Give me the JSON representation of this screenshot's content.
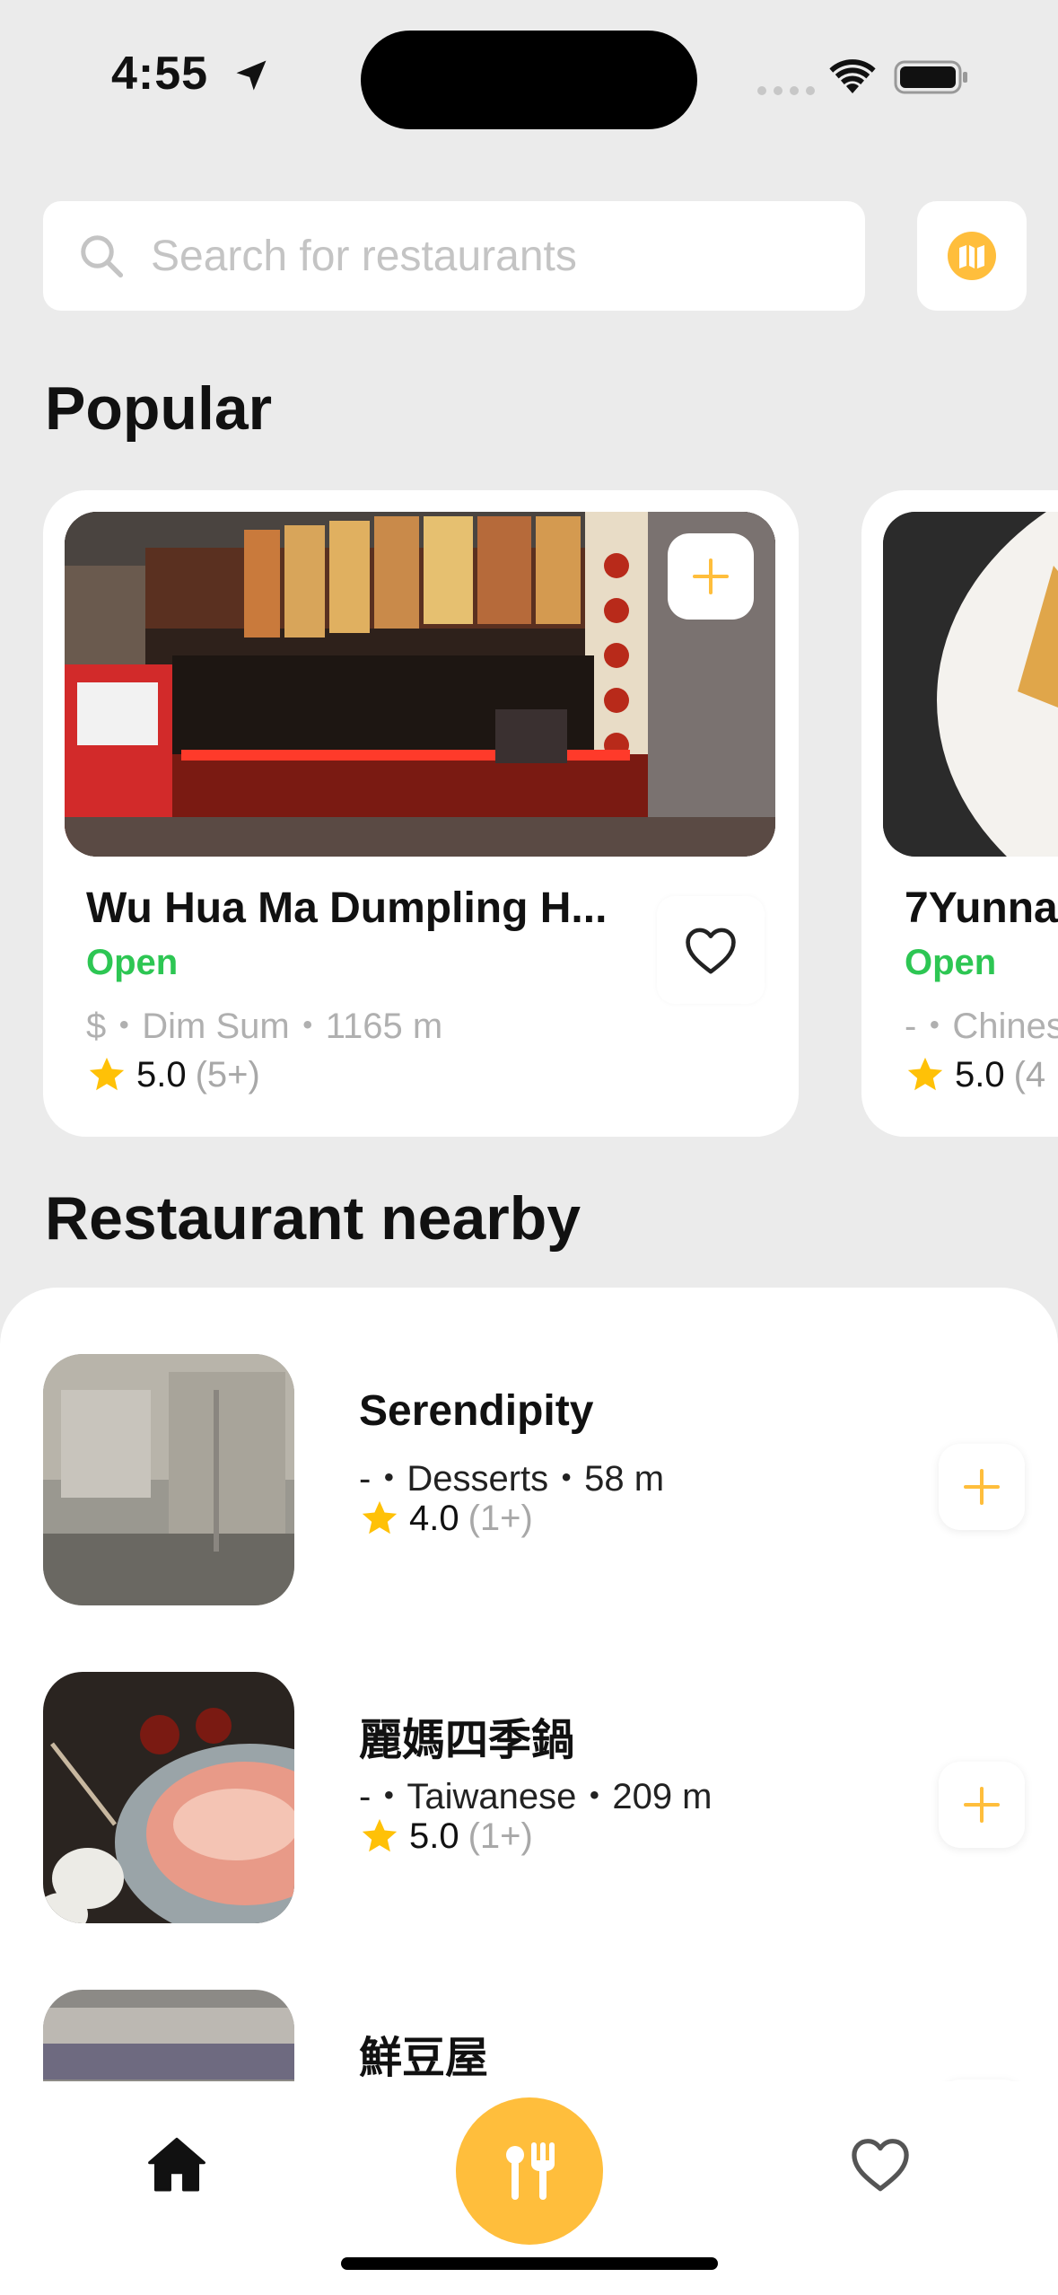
{
  "status_bar": {
    "time": "4:55"
  },
  "search": {
    "placeholder": "Search for restaurants"
  },
  "sections": {
    "popular": "Popular",
    "nearby": "Restaurant nearby"
  },
  "colors": {
    "accent": "#ffbe3c",
    "open_green": "#2dc653",
    "star": "#ffc107"
  },
  "popular": [
    {
      "name": "Wu Hua Ma Dumpling H...",
      "status": "Open",
      "meta": "$・Dim Sum・1165 m",
      "rating": "5.0",
      "count": "(5+)"
    },
    {
      "name": "7Yunna",
      "status": "Open",
      "meta": "-・Chines",
      "rating": "5.0",
      "count": "(4"
    }
  ],
  "nearby": [
    {
      "name": "Serendipity",
      "meta": "-・Desserts・58 m",
      "rating": "4.0",
      "count": "(1+)"
    },
    {
      "name": "麗媽四季鍋",
      "meta": "-・Taiwanese・209 m",
      "rating": "5.0",
      "count": "(1+)"
    },
    {
      "name": "鮮豆屋"
    }
  ],
  "icons": {
    "search": "search-icon",
    "map": "map-icon",
    "add": "plus-icon",
    "favorite": "heart-outline-icon",
    "star": "star-icon",
    "home": "home-icon",
    "dine": "utensils-icon"
  }
}
